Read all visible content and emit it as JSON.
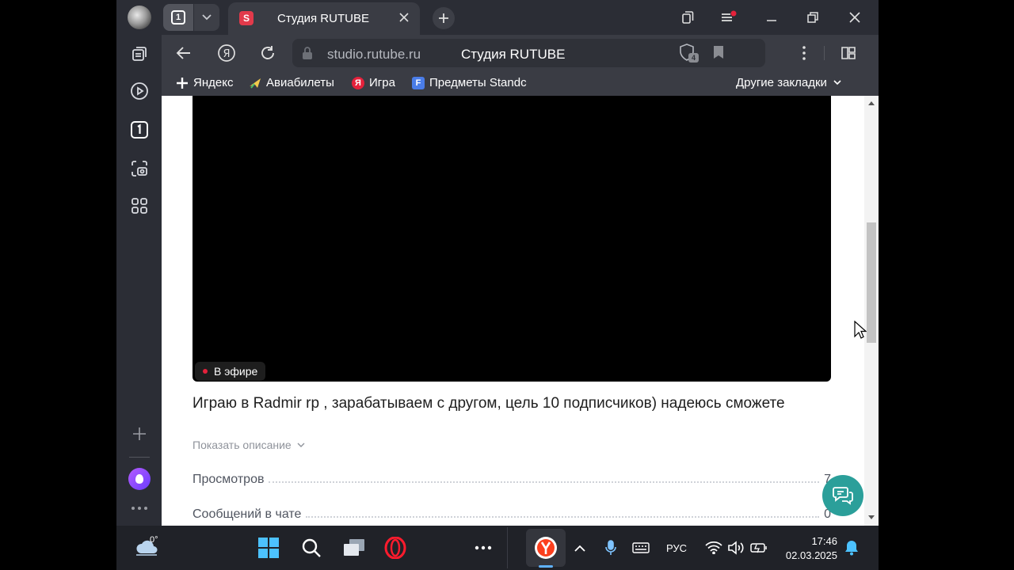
{
  "browser": {
    "tab_count": "1",
    "tab_title": "Студия RUTUBE",
    "tab_favicon": "S",
    "url": "studio.rutube.ru",
    "page_title": "Студия RUTUBE",
    "protect_badge": "4",
    "bookmarks": [
      {
        "label": "Яндекс",
        "icon": "plus-icon"
      },
      {
        "label": "Авиабилеты",
        "icon": "plane-icon"
      },
      {
        "label": "Игра",
        "icon": "yandex-icon",
        "glyph": "Я"
      },
      {
        "label": "Предметы Standc",
        "icon": "f-icon",
        "glyph": "F"
      }
    ],
    "other_bookmarks": "Другие закладки"
  },
  "video": {
    "live_label": "В эфире"
  },
  "stream": {
    "title": "Играю в Radmir rp , зарабатываем с другом, цель 10 подписчиков) надеюсь сможете",
    "show_description": "Показать описание"
  },
  "stats": [
    {
      "label": "Просмотров",
      "value": "7"
    },
    {
      "label": "Сообщений в чате",
      "value": "0"
    }
  ],
  "taskbar": {
    "weather_temp": "0°",
    "language": "РУС",
    "time": "17:46",
    "date": "02.03.2025"
  },
  "colors": {
    "accent_live": "#e5213b",
    "help_button": "#2b9f9a",
    "rutube_brand": "#e23a4b"
  }
}
